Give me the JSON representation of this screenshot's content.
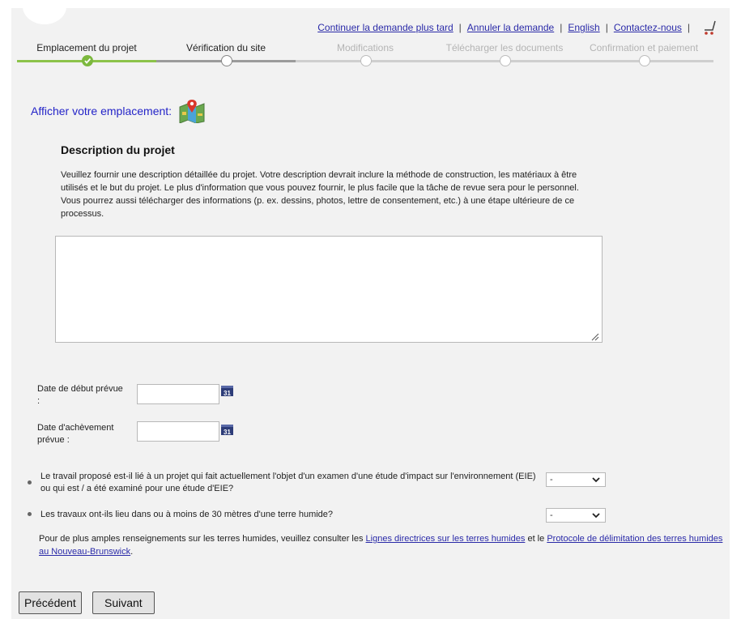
{
  "header": {
    "links": [
      {
        "label": "Continuer la demande plus tard"
      },
      {
        "label": "Annuler la demande"
      },
      {
        "label": "English"
      },
      {
        "label": "Contactez-nous"
      }
    ],
    "separator": "|"
  },
  "steps": [
    {
      "label": "Emplacement du projet",
      "state": "done"
    },
    {
      "label": "Vérification du site",
      "state": "pending"
    },
    {
      "label": "Modifications",
      "state": "disabled"
    },
    {
      "label": "Télécharger les documents",
      "state": "disabled"
    },
    {
      "label": "Confirmation et paiement",
      "state": "disabled"
    }
  ],
  "map_link": {
    "label": "Afficher votre emplacement:",
    "icon": "map-location-icon"
  },
  "description": {
    "title": "Description du projet",
    "text": "Veuillez fournir une description détaillée du projet. Votre description devrait inclure la méthode de construction, les matériaux à être utilisés et le but du projet. Le plus d'information que vous pouvez fournir, le plus facile que la tâche de revue sera pour le personnel. Vous pourrez aussi télécharger des informations (p. ex. dessins, photos, lettre de consentement, etc.) à une étape ultérieure de ce processus.",
    "value": ""
  },
  "dates": {
    "start_label": "Date de début prévue :",
    "start_value": "",
    "end_label": "Date d'achèvement prévue :",
    "end_value": "",
    "calendar_text": "31"
  },
  "questions": [
    {
      "text": "Le travail proposé est-il lié à un projet qui fait actuellement l'objet d'un examen d'une étude d'impact sur l'environnement (EIE) ou qui est / a été examiné pour une étude d'EIE?",
      "selected": "-"
    },
    {
      "text": "Les travaux ont-ils lieu dans ou à moins de 30 mètres d'une terre humide?",
      "selected": "-"
    }
  ],
  "info": {
    "prefix": "Pour de plus amples renseignements sur les terres humides, veuillez consulter les",
    "link1": "Lignes directrices sur les terres humides",
    "middle": "et le",
    "link2": "Protocole de délimitation des terres humides au Nouveau-Brunswick",
    "suffix": "."
  },
  "buttons": {
    "previous": "Précédent",
    "next": "Suivant"
  },
  "colors": {
    "link": "#2a2aa8",
    "step_done": "#7cb83e",
    "cart_accent": "#c0392b"
  }
}
